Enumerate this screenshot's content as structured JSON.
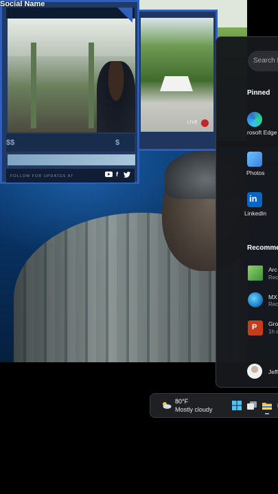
{
  "overlay": {
    "social_name": "Social Name",
    "price_left": "$$",
    "price_right": "$",
    "follow_text": "FOLLOW FOR UPDATES AT",
    "live_label": "LIVE",
    "social_icons": [
      "youtube-icon",
      "facebook-icon",
      "twitter-icon"
    ],
    "accent_color": "#2f5fb8"
  },
  "start_menu": {
    "search_placeholder": "Search fo",
    "pinned_header": "Pinned",
    "pinned": [
      {
        "label": "rosoft Edge",
        "icon": "edge-icon"
      },
      {
        "label": "Photos",
        "icon": "photos-icon"
      },
      {
        "label": "LinkedIn",
        "icon": "linkedin-icon"
      }
    ],
    "recommended_header": "Recommen",
    "recommended": [
      {
        "title": "Arc",
        "sub": "Rec",
        "icon": "monitor-icon"
      },
      {
        "title": "MX",
        "sub": "Rec",
        "icon": "globe-icon"
      },
      {
        "title": "Gro",
        "sub": "1h a",
        "icon": "powerpoint-icon"
      }
    ],
    "user_name": "Jeffe"
  },
  "taskbar": {
    "temperature": "80°F",
    "condition": "Mostly cloudy",
    "icons": [
      "start-icon",
      "task-view-icon",
      "file-explorer-icon",
      "edge-icon"
    ]
  }
}
